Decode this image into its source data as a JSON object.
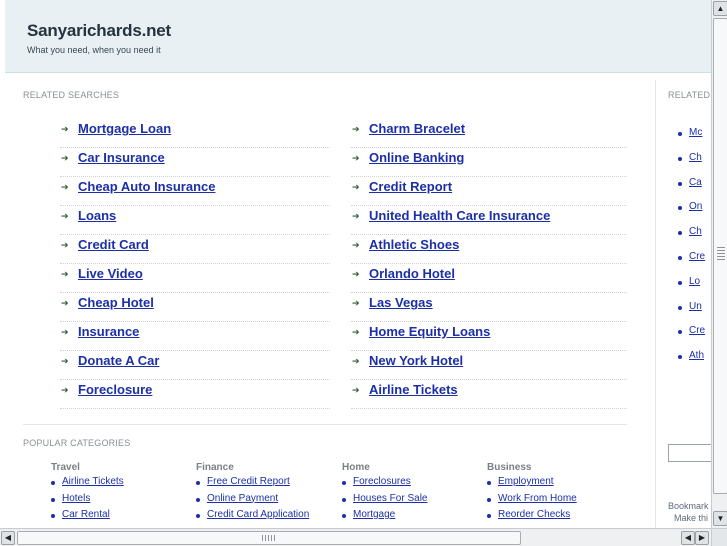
{
  "site": {
    "title": "Sanyarichards.net",
    "tagline": "What you need, when you need it"
  },
  "related": {
    "heading": "RELATED SEARCHES",
    "left": [
      "Mortgage Loan",
      "Car Insurance",
      "Cheap Auto Insurance",
      "Loans",
      "Credit Card",
      "Live Video",
      "Cheap Hotel",
      "Insurance",
      "Donate A Car",
      "Foreclosure"
    ],
    "right": [
      "Charm Bracelet",
      "Online Banking",
      "Credit Report",
      "United Health Care Insurance",
      "Athletic Shoes",
      "Orlando Hotel",
      "Las Vegas",
      "Home Equity Loans",
      "New York Hotel",
      "Airline Tickets"
    ]
  },
  "popular": {
    "heading": "POPULAR CATEGORIES",
    "categories": [
      {
        "title": "Travel",
        "items": [
          "Airline Tickets",
          "Hotels",
          "Car Rental"
        ]
      },
      {
        "title": "Finance",
        "items": [
          "Free Credit Report",
          "Online Payment",
          "Credit Card Application"
        ]
      },
      {
        "title": "Home",
        "items": [
          "Foreclosures",
          "Houses For Sale",
          "Mortgage"
        ]
      },
      {
        "title": "Business",
        "items": [
          "Employment",
          "Work From Home",
          "Reorder Checks"
        ]
      }
    ]
  },
  "side": {
    "heading": "RELATED",
    "items": [
      "Mc",
      "Ch",
      "Ca",
      "On",
      "Ch",
      "Cre",
      "Lo",
      "Un",
      "Cre",
      "Ath"
    ],
    "bookmark_line1": "Bookmark",
    "bookmark_line2": "Make thi"
  },
  "icons": {
    "arrow": "right-arrow-icon",
    "scroll_up": "▲",
    "scroll_down": "▼",
    "scroll_left": "◀",
    "scroll_right": "▶"
  },
  "colors": {
    "link": "#1c2fa8",
    "header_bg": "#e9f0f4"
  }
}
